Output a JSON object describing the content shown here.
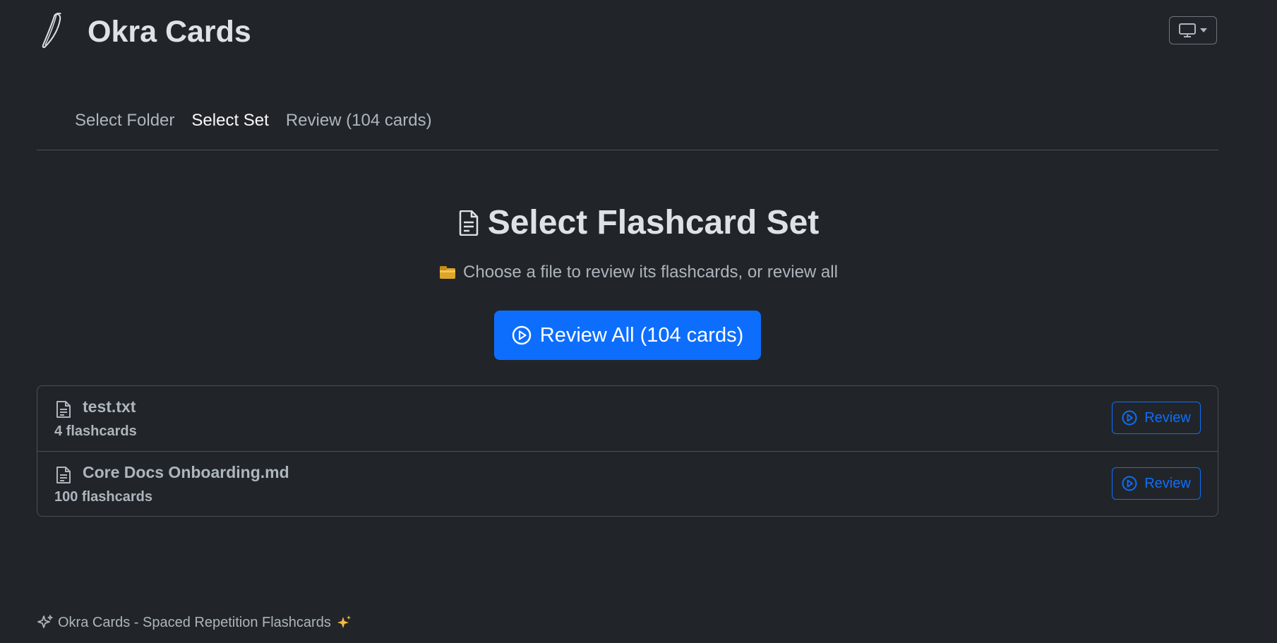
{
  "header": {
    "app_title": "Okra Cards",
    "logo_icon": "okra-icon",
    "theme_toggle_icon": "monitor-icon"
  },
  "nav": {
    "steps": [
      {
        "label": "Select Folder",
        "active": false
      },
      {
        "label": "Select Set",
        "active": true
      },
      {
        "label": "Review (104 cards)",
        "active": false
      }
    ]
  },
  "main": {
    "heading": "Select Flashcard Set",
    "heading_icon": "file-text-icon",
    "subheading": "Choose a file to review its flashcards, or review all",
    "subheading_icon": "card-index-dividers-icon",
    "review_all_label": "Review All (104 cards)",
    "review_all_icon": "play-circle-icon"
  },
  "files": [
    {
      "name": "test.txt",
      "count": "4 flashcards",
      "button_label": "Review"
    },
    {
      "name": "Core Docs Onboarding.md",
      "count": "100 flashcards",
      "button_label": "Review"
    }
  ],
  "footer": {
    "text": "Okra Cards - Spaced Repetition Flashcards",
    "leading_icon": "sparkles-outline-icon",
    "trailing_icon": "sparkles-icon"
  },
  "colors": {
    "background": "#212529",
    "primary": "#0d6efd",
    "muted_text": "#adb5bd",
    "border": "#495057"
  }
}
